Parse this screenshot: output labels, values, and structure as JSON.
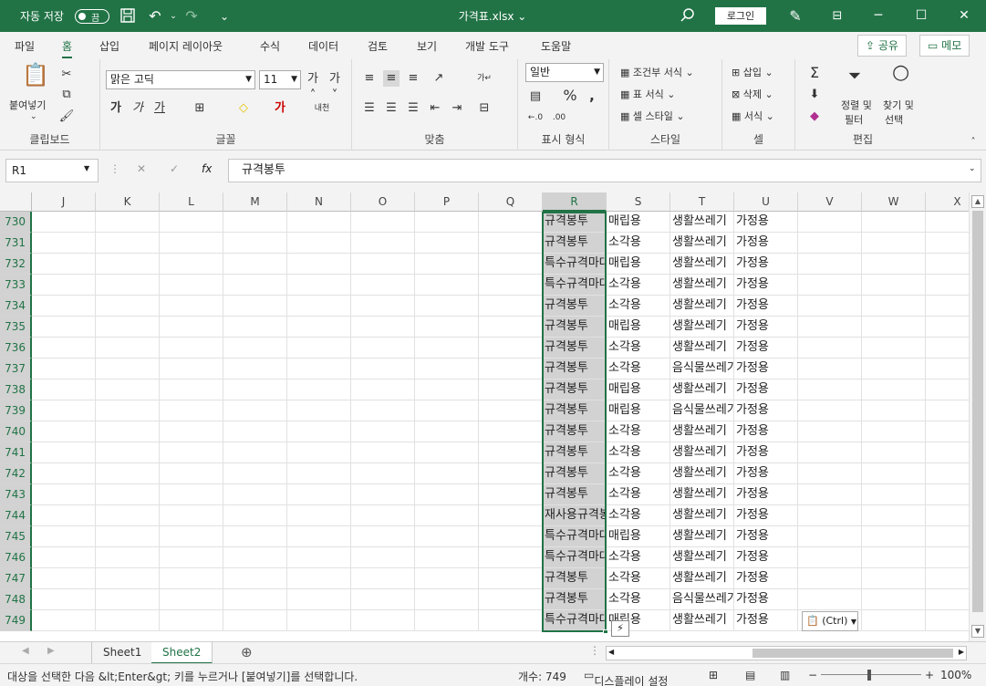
{
  "titlebar": {
    "autosave_label": "자동 저장",
    "toggle_state": "끔",
    "filename": "가격표.xlsx ⌄",
    "login_label": "로그인"
  },
  "ribbon_tabs": [
    "파일",
    "홈",
    "삽입",
    "페이지 레이아웃",
    "수식",
    "데이터",
    "검토",
    "보기",
    "개발 도구",
    "도움말"
  ],
  "share_label": "공유",
  "memo_label": "메모",
  "ribbon": {
    "clipboard": {
      "paste_label": "붙여넣기",
      "group_label": "클립보드"
    },
    "font": {
      "font_name": "맑은 고딕",
      "font_size": "11",
      "group_label": "글꼴"
    },
    "alignment": {
      "group_label": "맞춤"
    },
    "number": {
      "format": "일반",
      "group_label": "표시 형식"
    },
    "styles": {
      "conditional": "조건부 서식",
      "table": "표 서식",
      "cell": "셀 스타일",
      "group_label": "스타일"
    },
    "cells": {
      "insert": "삽입",
      "delete": "삭제",
      "format": "서식",
      "group_label": "셀"
    },
    "editing": {
      "sort_filter_1": "정렬 및",
      "sort_filter_2": "필터",
      "find_select_1": "찾기 및",
      "find_select_2": "선택",
      "group_label": "편집"
    }
  },
  "formula": {
    "name_box": "R1",
    "value": "규격봉투"
  },
  "columns": [
    "J",
    "K",
    "L",
    "M",
    "N",
    "O",
    "P",
    "Q",
    "R",
    "S",
    "T",
    "U",
    "V",
    "W",
    "X"
  ],
  "rows": [
    {
      "num": "730",
      "R": "규격봉투",
      "S": "매립용",
      "T": "생활쓰레기",
      "U": "가정용"
    },
    {
      "num": "731",
      "R": "규격봉투",
      "S": "소각용",
      "T": "생활쓰레기",
      "U": "가정용"
    },
    {
      "num": "732",
      "R": "특수규격마대",
      "S": "매립용",
      "T": "생활쓰레기",
      "U": "가정용"
    },
    {
      "num": "733",
      "R": "특수규격마대",
      "S": "소각용",
      "T": "생활쓰레기",
      "U": "가정용"
    },
    {
      "num": "734",
      "R": "규격봉투",
      "S": "소각용",
      "T": "생활쓰레기",
      "U": "가정용"
    },
    {
      "num": "735",
      "R": "규격봉투",
      "S": "매립용",
      "T": "생활쓰레기",
      "U": "가정용"
    },
    {
      "num": "736",
      "R": "규격봉투",
      "S": "소각용",
      "T": "생활쓰레기",
      "U": "가정용"
    },
    {
      "num": "737",
      "R": "규격봉투",
      "S": "소각용",
      "T": "음식물쓰레기",
      "U": "가정용"
    },
    {
      "num": "738",
      "R": "규격봉투",
      "S": "매립용",
      "T": "생활쓰레기",
      "U": "가정용"
    },
    {
      "num": "739",
      "R": "규격봉투",
      "S": "매립용",
      "T": "음식물쓰레기",
      "U": "가정용"
    },
    {
      "num": "740",
      "R": "규격봉투",
      "S": "소각용",
      "T": "생활쓰레기",
      "U": "가정용"
    },
    {
      "num": "741",
      "R": "규격봉투",
      "S": "소각용",
      "T": "생활쓰레기",
      "U": "가정용"
    },
    {
      "num": "742",
      "R": "규격봉투",
      "S": "소각용",
      "T": "생활쓰레기",
      "U": "가정용"
    },
    {
      "num": "743",
      "R": "규격봉투",
      "S": "소각용",
      "T": "생활쓰레기",
      "U": "가정용"
    },
    {
      "num": "744",
      "R": "재사용규격봉투",
      "S": "소각용",
      "T": "생활쓰레기",
      "U": "가정용"
    },
    {
      "num": "745",
      "R": "특수규격마대",
      "S": "매립용",
      "T": "생활쓰레기",
      "U": "가정용"
    },
    {
      "num": "746",
      "R": "특수규격마대",
      "S": "소각용",
      "T": "생활쓰레기",
      "U": "가정용"
    },
    {
      "num": "747",
      "R": "규격봉투",
      "S": "소각용",
      "T": "생활쓰레기",
      "U": "가정용"
    },
    {
      "num": "748",
      "R": "규격봉투",
      "S": "소각용",
      "T": "음식물쓰레기",
      "U": "가정용"
    },
    {
      "num": "749",
      "R": "특수규격마대",
      "S": "매립용",
      "T": "생활쓰레기",
      "U": "가정용"
    }
  ],
  "paste_options_label": "(Ctrl)",
  "sheets": [
    "Sheet1",
    "Sheet2"
  ],
  "active_sheet": "Sheet2",
  "status": {
    "message": "대상을 선택한 다음 &lt;Enter&gt; 키를 누르거나 [붙여넣기]를 선택합니다.",
    "count": "개수: 749",
    "display_settings": "디스플레이 설정",
    "zoom": "100%"
  },
  "colors": {
    "accent": "#217346",
    "selection_fill": "#d2d2d2"
  }
}
